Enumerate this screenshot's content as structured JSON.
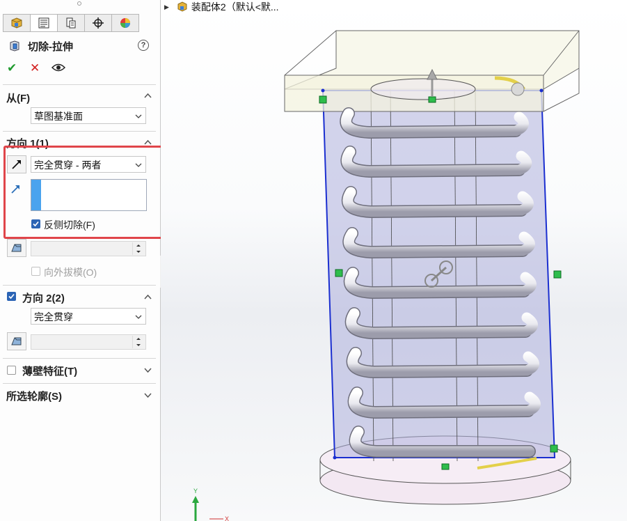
{
  "window": {
    "breadcrumb": "装配体2（默认<默..."
  },
  "panel": {
    "tabs": [
      "feature-manager",
      "property-manager",
      "configuration-manager",
      "dimxpert-manager",
      "display-manager"
    ],
    "title": "切除-拉伸",
    "help": "?",
    "actions": {
      "ok": "✔",
      "cancel": "✕",
      "preview": "👁"
    },
    "from": {
      "label": "从(F)",
      "value": "草图基准面"
    },
    "direction1": {
      "label": "方向 1(1)",
      "end_condition": "完全贯穿 - 两者",
      "flip_side_cut": "反侧切除(F)",
      "flip_side_cut_checked": true,
      "draft_outward": "向外拔模(O)",
      "draft_outward_checked": false
    },
    "direction2": {
      "label": "方向 2(2)",
      "checked": true,
      "end_condition": "完全贯穿"
    },
    "thin_feature": {
      "label": "薄壁特征(T)",
      "checked": false
    },
    "selected_contours": {
      "label": "所选轮廓(S)"
    }
  },
  "colors": {
    "accent": "#2b64b5",
    "highlight": "#e0454a",
    "select_blue": "#4aa3ee",
    "ok": "#1f9a2e",
    "cancel": "#d22020"
  },
  "viewport": {
    "triad": {
      "y": "Y",
      "x": "X"
    }
  }
}
